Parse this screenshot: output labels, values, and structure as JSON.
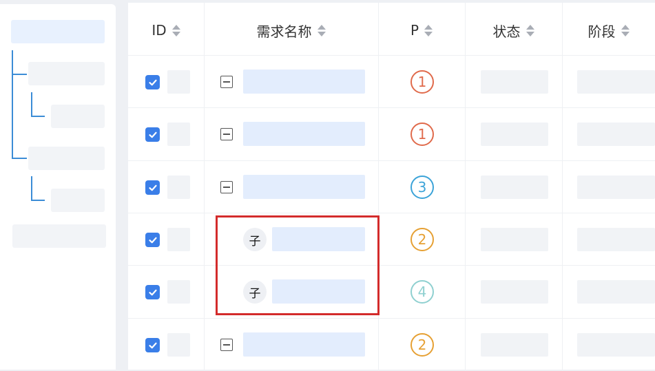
{
  "table": {
    "columns": [
      {
        "label": "ID"
      },
      {
        "label": "需求名称"
      },
      {
        "label": "P"
      },
      {
        "label": "状态"
      },
      {
        "label": "阶段"
      }
    ],
    "rows": [
      {
        "checked": true,
        "expandable": true,
        "child_label": "",
        "priority": "1",
        "priority_color": "#e06a4b"
      },
      {
        "checked": true,
        "expandable": true,
        "child_label": "",
        "priority": "1",
        "priority_color": "#e06a4b"
      },
      {
        "checked": true,
        "expandable": true,
        "child_label": "",
        "priority": "3",
        "priority_color": "#3ba3d8"
      },
      {
        "checked": true,
        "expandable": false,
        "child_label": "子",
        "priority": "2",
        "priority_color": "#e6a033"
      },
      {
        "checked": true,
        "expandable": false,
        "child_label": "子",
        "priority": "4",
        "priority_color": "#8fd0d0"
      },
      {
        "checked": true,
        "expandable": true,
        "child_label": "",
        "priority": "2",
        "priority_color": "#e6a033"
      }
    ]
  },
  "colors": {
    "checkbox": "#3a7ee8",
    "highlight_box": "#d32b2b",
    "tree_line": "#3b8cd6"
  }
}
